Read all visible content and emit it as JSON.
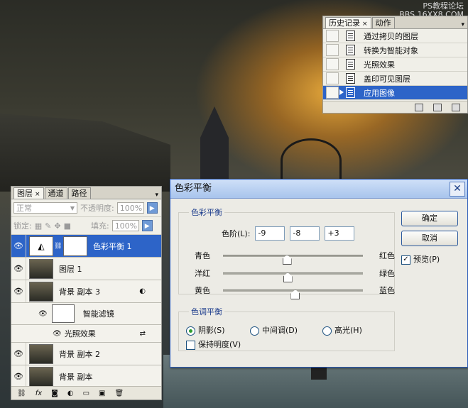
{
  "watermark": {
    "line1": "PS教程论坛",
    "line2": "BBS.16XX8.COM"
  },
  "history": {
    "tabs": [
      {
        "label": "历史记录",
        "active": true,
        "close": "×"
      },
      {
        "label": "动作",
        "active": false
      }
    ],
    "menu": "▾",
    "items": [
      {
        "label": "通过拷贝的图层",
        "selected": false
      },
      {
        "label": "转换为智能对象",
        "selected": false
      },
      {
        "label": "光照效果",
        "selected": false
      },
      {
        "label": "盖印可见图层",
        "selected": false
      },
      {
        "label": "应用图像",
        "selected": true
      }
    ]
  },
  "layers": {
    "tabs": [
      {
        "label": "图层",
        "active": true,
        "close": "×"
      },
      {
        "label": "通道",
        "active": false
      },
      {
        "label": "路径",
        "active": false
      }
    ],
    "blend_mode": "正常",
    "opacity_label": "不透明度:",
    "opacity_value": "100%",
    "lock_label": "锁定:",
    "fill_label": "填充:",
    "fill_value": "100%",
    "rows": [
      {
        "name": "色彩平衡 1",
        "selected": true
      },
      {
        "name": "图层 1",
        "selected": false
      },
      {
        "name": "背景 副本 3",
        "selected": false
      },
      {
        "name": "智能滤镜",
        "selected": false
      },
      {
        "name": "光照效果",
        "selected": false
      },
      {
        "name": "背景 副本 2",
        "selected": false
      },
      {
        "name": "背景 副本",
        "selected": false
      }
    ],
    "footer_fx": "fx"
  },
  "dialog": {
    "title": "色彩平衡",
    "close": "✕",
    "color_balance_legend": "色彩平衡",
    "levels_label": "色阶(L):",
    "levels": [
      "-9",
      "-8",
      "+3"
    ],
    "sliders": [
      {
        "left": "青色",
        "right": "红色",
        "value": -9
      },
      {
        "left": "洋红",
        "right": "绿色",
        "value": -8
      },
      {
        "left": "黄色",
        "right": "蓝色",
        "value": 3
      }
    ],
    "tone_legend": "色调平衡",
    "tones": [
      {
        "label": "阴影(S)",
        "checked": true
      },
      {
        "label": "中间调(D)",
        "checked": false
      },
      {
        "label": "高光(H)",
        "checked": false
      }
    ],
    "preserve_label": "保持明度(V)",
    "preserve_checked": false,
    "ok_label": "确定",
    "cancel_label": "取消",
    "preview_label": "预览(P)",
    "preview_checked": true,
    "slider_range": [
      -100,
      100
    ]
  }
}
